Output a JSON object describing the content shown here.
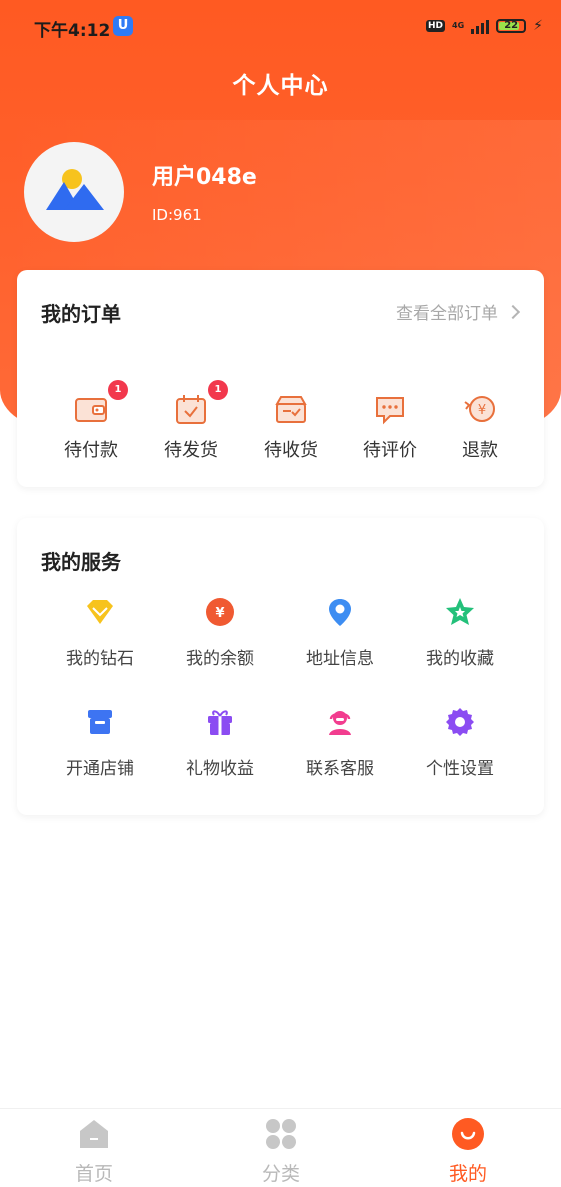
{
  "status": {
    "time": "下午4:12",
    "app_icon": "U",
    "hd": "HD",
    "network": "4G",
    "battery": "22"
  },
  "header": {
    "title": "个人中心"
  },
  "profile": {
    "username": "用户048e",
    "id": "ID:961"
  },
  "orders": {
    "title": "我的订单",
    "view_all": "查看全部订单",
    "items": [
      {
        "label": "待付款",
        "badge": "1",
        "icon": "wallet-icon"
      },
      {
        "label": "待发货",
        "badge": "1",
        "icon": "calendar-check-icon"
      },
      {
        "label": "待收货",
        "badge": "",
        "icon": "box-icon"
      },
      {
        "label": "待评价",
        "badge": "",
        "icon": "comment-icon"
      },
      {
        "label": "退款",
        "badge": "",
        "icon": "refund-icon"
      }
    ]
  },
  "services": {
    "title": "我的服务",
    "items": [
      {
        "label": "我的钻石",
        "icon": "diamond-icon",
        "color": "#f5b81f"
      },
      {
        "label": "我的余额",
        "icon": "yen-coin-icon",
        "color": "#f05a32"
      },
      {
        "label": "地址信息",
        "icon": "location-pin-icon",
        "color": "#3d8df2"
      },
      {
        "label": "我的收藏",
        "icon": "star-icon",
        "color": "#23c07a"
      },
      {
        "label": "开通店铺",
        "icon": "store-icon",
        "color": "#3d74f2"
      },
      {
        "label": "礼物收益",
        "icon": "gift-icon",
        "color": "#8b4cf2"
      },
      {
        "label": "联系客服",
        "icon": "headset-icon",
        "color": "#f23d8f"
      },
      {
        "label": "个性设置",
        "icon": "gear-icon",
        "color": "#8b4cf2"
      }
    ]
  },
  "tabbar": {
    "items": [
      {
        "label": "首页",
        "icon": "home-icon",
        "active": false
      },
      {
        "label": "分类",
        "icon": "category-icon",
        "active": false
      },
      {
        "label": "我的",
        "icon": "profile-smile-icon",
        "active": true
      }
    ]
  },
  "colors": {
    "brand": "#ff5a22",
    "badge": "#f2384d"
  }
}
